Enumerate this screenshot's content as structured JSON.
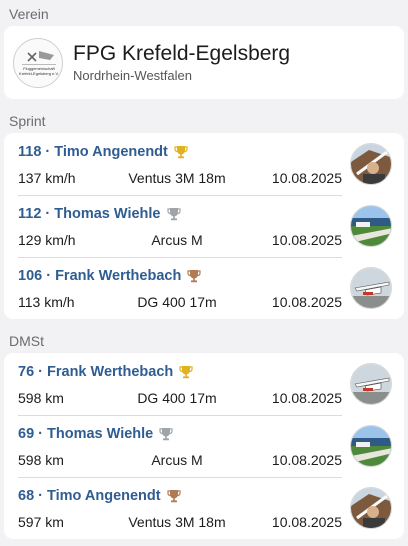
{
  "club_section": {
    "title": "Verein",
    "name": "FPG Krefeld-Egelsberg",
    "region": "Nordrhein-Westfalen",
    "logo_text_1": "Fluggemeinschaft",
    "logo_text_2": "Krefeld-Egelsberg e.V."
  },
  "sprint": {
    "title": "Sprint",
    "entries": [
      {
        "title": "118 · Timo Angenendt",
        "trophy": "gold-trophy-icon",
        "trophy_color": "#e3b11e",
        "value": "137 km/h",
        "plane": "Ventus 3M 18m",
        "date": "10.08.2025",
        "avatar": "pilot-photo"
      },
      {
        "title": "112 · Thomas Wiehle",
        "trophy": "silver-trophy-icon",
        "trophy_color": "#9fa4a9",
        "value": "129 km/h",
        "plane": "Arcus M",
        "date": "10.08.2025",
        "avatar": "airfield-photo"
      },
      {
        "title": "106 · Frank Werthebach",
        "trophy": "bronze-trophy-icon",
        "trophy_color": "#b07a55",
        "value": "113 km/h",
        "plane": "DG 400 17m",
        "date": "10.08.2025",
        "avatar": "glider-photo"
      }
    ]
  },
  "dmst": {
    "title": "DMSt",
    "entries": [
      {
        "title": "76 · Frank Werthebach",
        "trophy": "gold-trophy-icon",
        "trophy_color": "#e3b11e",
        "value": "598 km",
        "plane": "DG 400 17m",
        "date": "10.08.2025",
        "avatar": "glider-photo"
      },
      {
        "title": "69 · Thomas Wiehle",
        "trophy": "silver-trophy-icon",
        "trophy_color": "#9fa4a9",
        "value": "598 km",
        "plane": "Arcus M",
        "date": "10.08.2025",
        "avatar": "airfield-photo"
      },
      {
        "title": "68 · Timo Angenendt",
        "trophy": "bronze-trophy-icon",
        "trophy_color": "#b07a55",
        "value": "597 km",
        "plane": "Ventus 3M 18m",
        "date": "10.08.2025",
        "avatar": "pilot-photo"
      }
    ]
  },
  "colors": {
    "link_blue": "#2f5d92",
    "background": "#f2f2f4"
  }
}
